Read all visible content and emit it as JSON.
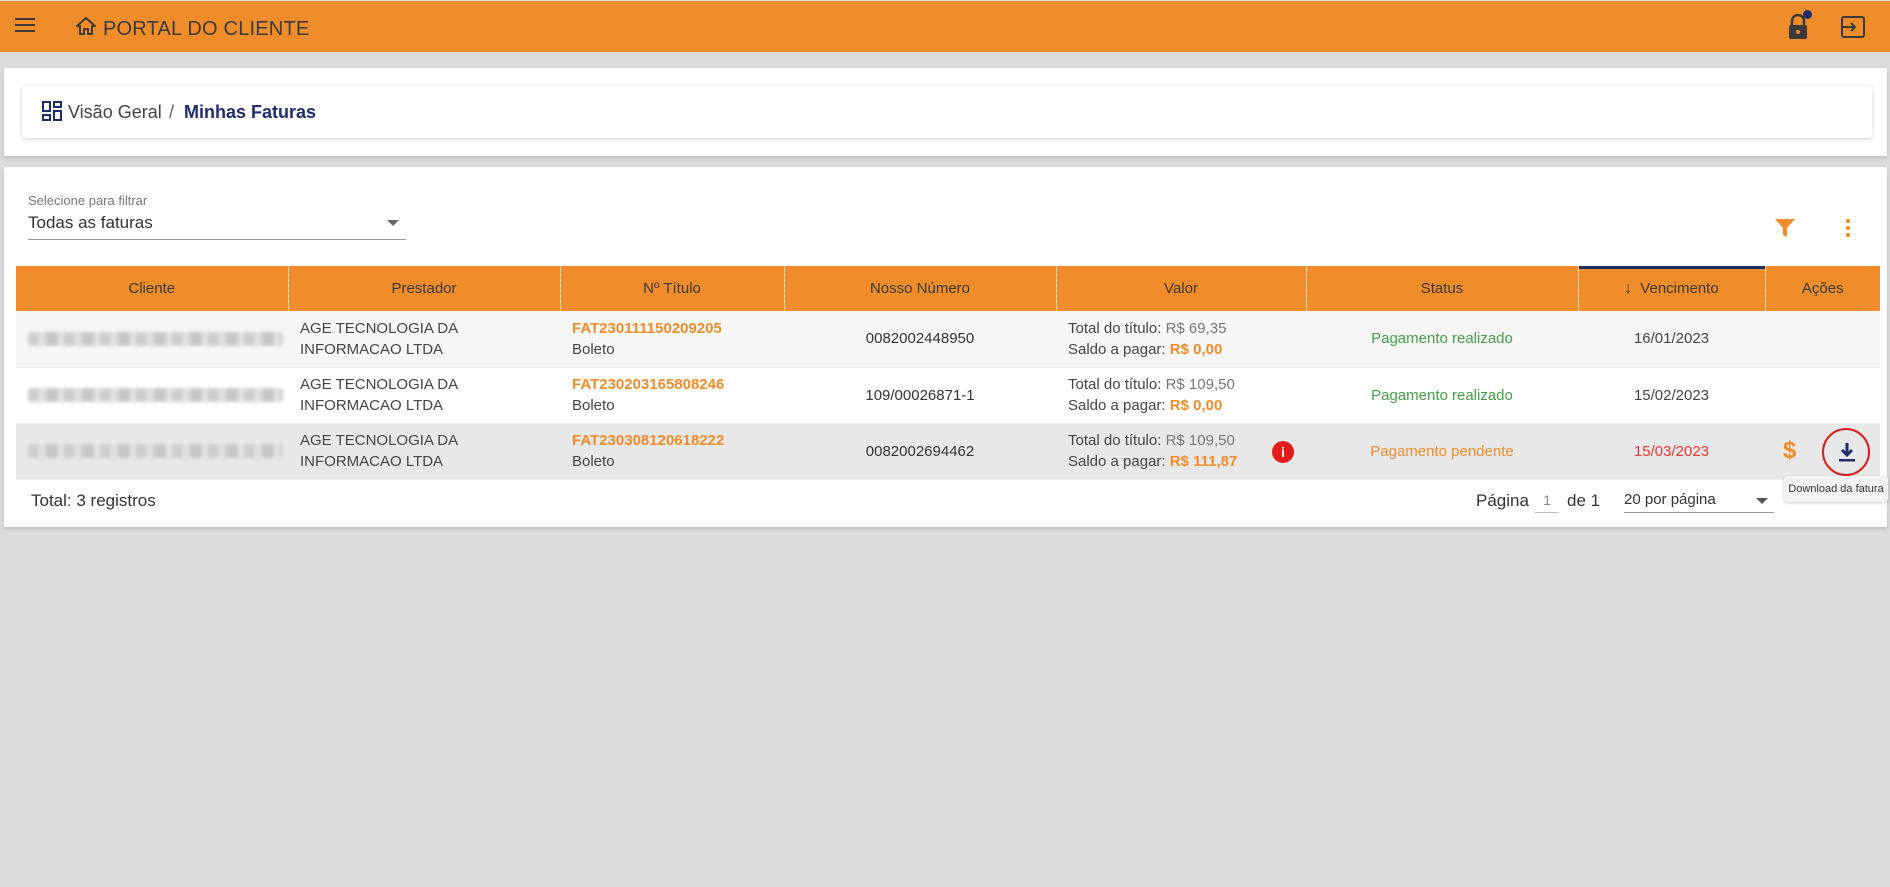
{
  "header": {
    "app_title": "PORTAL DO CLIENTE",
    "menu_icon": "hamburger-menu-icon",
    "home_icon": "home-icon",
    "lock_icon": "lock-icon",
    "logout_icon": "logout-icon",
    "accent_color": "#f08c2a",
    "notification_dot_color": "#1e2d6e"
  },
  "breadcrumb": {
    "root_label": "Visão Geral",
    "separator": "/",
    "current_label": "Minhas Faturas"
  },
  "filter": {
    "label": "Selecione para filtrar",
    "value": "Todas as faturas"
  },
  "table": {
    "columns": [
      "Cliente",
      "Prestador",
      "Nº Título",
      "Nosso Número",
      "Valor",
      "Status",
      "Vencimento",
      "Ações"
    ],
    "sorted_column": "Vencimento",
    "rows": [
      {
        "cliente": "",
        "prestador": "AGE TECNOLOGIA DA INFORMACAO LTDA",
        "titulo": "FAT230111150209205",
        "tipo": "Boleto",
        "nosso_numero": "0082002448950",
        "total_label": "Total do título:",
        "total": "R$ 69,35",
        "saldo_label": "Saldo a pagar:",
        "saldo": "R$ 0,00",
        "status": "Pagamento realizado",
        "vencimento": "16/01/2023"
      },
      {
        "cliente": "",
        "prestador": "AGE TECNOLOGIA DA INFORMACAO LTDA",
        "titulo": "FAT230203165808246",
        "tipo": "Boleto",
        "nosso_numero": "109/00026871-1",
        "total_label": "Total do título:",
        "total": "R$ 109,50",
        "saldo_label": "Saldo a pagar:",
        "saldo": "R$ 0,00",
        "status": "Pagamento realizado",
        "vencimento": "15/02/2023"
      },
      {
        "cliente": "",
        "prestador": "AGE TECNOLOGIA DA INFORMACAO LTDA",
        "titulo": "FAT230308120618222",
        "tipo": "Boleto",
        "nosso_numero": "0082002694462",
        "total_label": "Total do título:",
        "total": "R$ 109,50",
        "saldo_label": "Saldo a pagar:",
        "saldo": "R$ 111,87",
        "info_glyph": "i",
        "status": "Pagamento pendente",
        "vencimento": "15/03/2023",
        "action_pay_glyph": "$"
      }
    ]
  },
  "footer": {
    "total": "Total: 3 registros",
    "page_label": "Página",
    "page_current": "1",
    "page_of": "de 1",
    "per_page": "20 por página"
  },
  "tooltip": "Download da fatura",
  "status_colors": {
    "paid": "#43a047",
    "pending": "#f08c2a",
    "overdue": "#e53935"
  }
}
